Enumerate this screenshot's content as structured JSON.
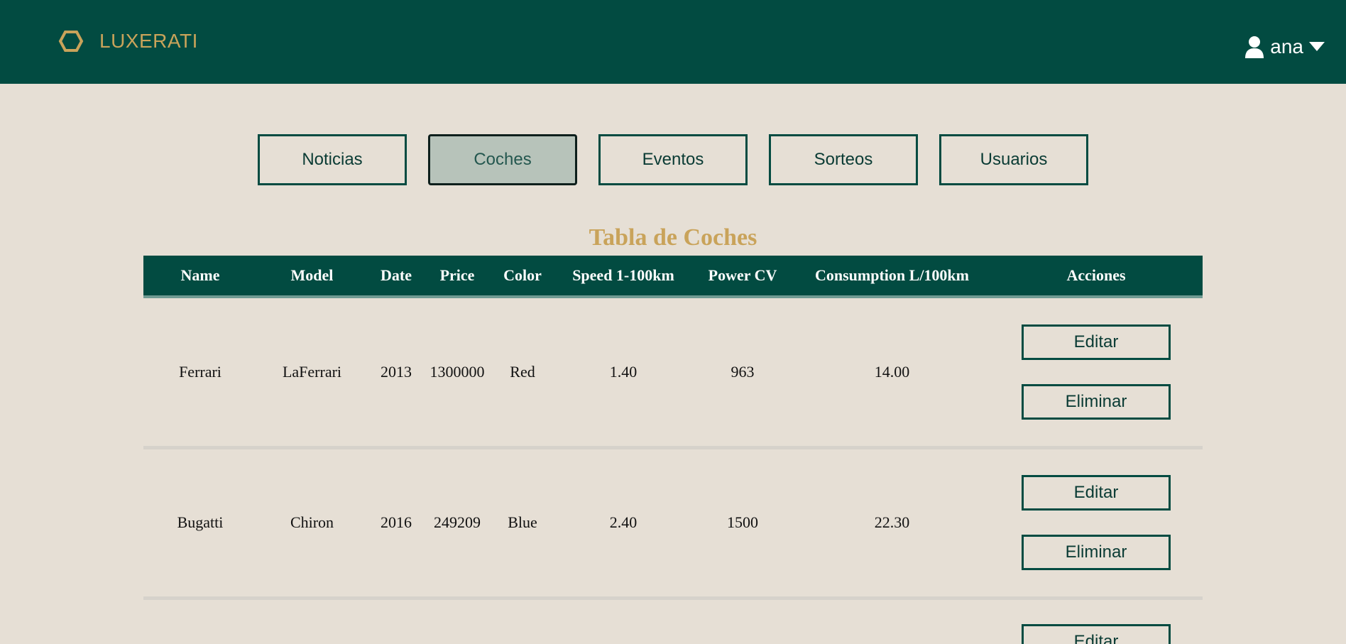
{
  "brand": {
    "name": "LUXERATI",
    "logo_icon": "hexagon-icon",
    "accent": "#c9a35a"
  },
  "user": {
    "name": "ana",
    "icon": "user-icon",
    "menu_icon": "caret-down-icon"
  },
  "colors": {
    "header_bg": "#024b41",
    "page_bg": "#e6dfd5",
    "gold": "#c9a35a"
  },
  "tabs": [
    {
      "label": "Noticias",
      "active": false
    },
    {
      "label": "Coches",
      "active": true
    },
    {
      "label": "Eventos",
      "active": false
    },
    {
      "label": "Sorteos",
      "active": false
    },
    {
      "label": "Usuarios",
      "active": false
    }
  ],
  "table": {
    "title": "Tabla de Coches",
    "columns": [
      "Name",
      "Model",
      "Date",
      "Price",
      "Color",
      "Speed 1-100km",
      "Power CV",
      "Consumption L/100km",
      "Acciones"
    ],
    "rows": [
      {
        "name": "Ferrari",
        "model": "LaFerrari",
        "date": "2013",
        "price": "1300000",
        "color": "Red",
        "speed": "1.40",
        "power": "963",
        "consumption": "14.00"
      },
      {
        "name": "Bugatti",
        "model": "Chiron",
        "date": "2016",
        "price": "249209",
        "color": "Blue",
        "speed": "2.40",
        "power": "1500",
        "consumption": "22.30"
      }
    ],
    "edit_label": "Editar",
    "delete_label": "Eliminar"
  }
}
